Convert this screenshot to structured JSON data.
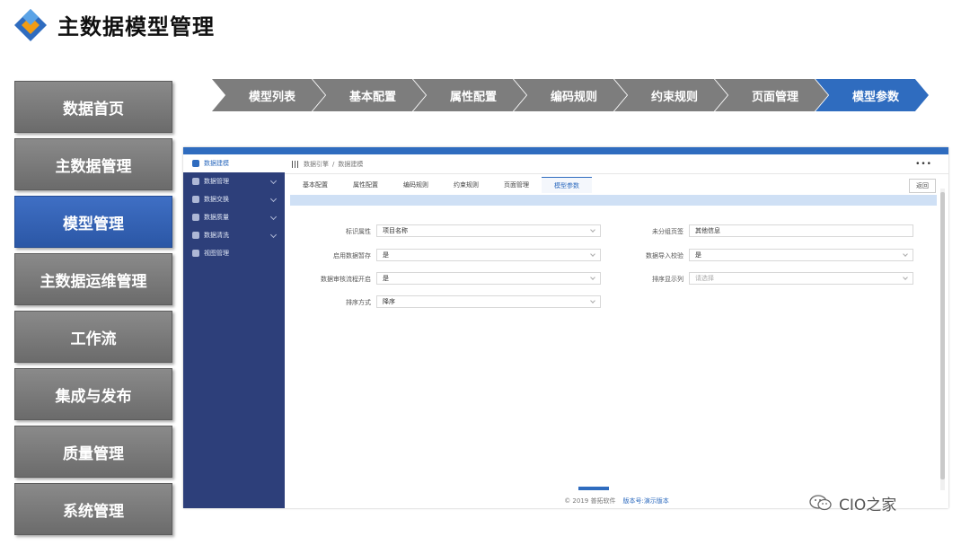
{
  "title": "主数据模型管理",
  "left_menu": [
    {
      "label": "数据首页",
      "active": false
    },
    {
      "label": "主数据管理",
      "active": false
    },
    {
      "label": "模型管理",
      "active": true
    },
    {
      "label": "主数据运维管理",
      "active": false
    },
    {
      "label": "工作流",
      "active": false
    },
    {
      "label": "集成与发布",
      "active": false
    },
    {
      "label": "质量管理",
      "active": false
    },
    {
      "label": "系统管理",
      "active": false
    }
  ],
  "steps": [
    {
      "label": "模型列表",
      "active": false
    },
    {
      "label": "基本配置",
      "active": false
    },
    {
      "label": "属性配置",
      "active": false
    },
    {
      "label": "编码规则",
      "active": false
    },
    {
      "label": "约束规则",
      "active": false
    },
    {
      "label": "页面管理",
      "active": false
    },
    {
      "label": "模型参数",
      "active": true
    }
  ],
  "app": {
    "sidebar": [
      {
        "label": "数据建模",
        "icon": "user-icon",
        "active": true,
        "chevron": false
      },
      {
        "label": "数据管理",
        "icon": "gear-icon",
        "active": false,
        "chevron": true
      },
      {
        "label": "数据交换",
        "icon": "exchange-icon",
        "active": false,
        "chevron": true
      },
      {
        "label": "数据质量",
        "icon": "quality-icon",
        "active": false,
        "chevron": true
      },
      {
        "label": "数据清洗",
        "icon": "clean-icon",
        "active": false,
        "chevron": true
      },
      {
        "label": "视图管理",
        "icon": "view-icon",
        "active": false,
        "chevron": false
      }
    ],
    "breadcrumb": {
      "root": "数据引擎",
      "separator": "/",
      "current": "数据建模"
    },
    "tabs": [
      {
        "label": "基本配置",
        "active": false
      },
      {
        "label": "属性配置",
        "active": false
      },
      {
        "label": "编码规则",
        "active": false
      },
      {
        "label": "约束规则",
        "active": false
      },
      {
        "label": "页面管理",
        "active": false
      },
      {
        "label": "模型参数",
        "active": true
      }
    ],
    "back_button": "返回",
    "form": {
      "left": [
        {
          "label": "标识属性",
          "value": "项目名称"
        },
        {
          "label": "启用数据暂存",
          "value": "是"
        },
        {
          "label": "数据审核流程开启",
          "value": "是"
        },
        {
          "label": "排序方式",
          "value": "降序"
        }
      ],
      "right": [
        {
          "label": "未分组页签",
          "value": "其他信息",
          "placeholder": false,
          "dropdown": false
        },
        {
          "label": "数据导入校验",
          "value": "是",
          "placeholder": false,
          "dropdown": true
        },
        {
          "label": "排序显示列",
          "value": "请选择",
          "placeholder": true,
          "dropdown": true
        }
      ]
    },
    "footer": {
      "copyright": "© 2019 普拓软件",
      "version_label": "版本号:",
      "version_value": "演示版本"
    }
  },
  "watermark": "CIO之家",
  "colors": {
    "accent": "#2f6cbf",
    "sidebar": "#2d3f7a",
    "menu_gray": "#7d7d7d"
  }
}
